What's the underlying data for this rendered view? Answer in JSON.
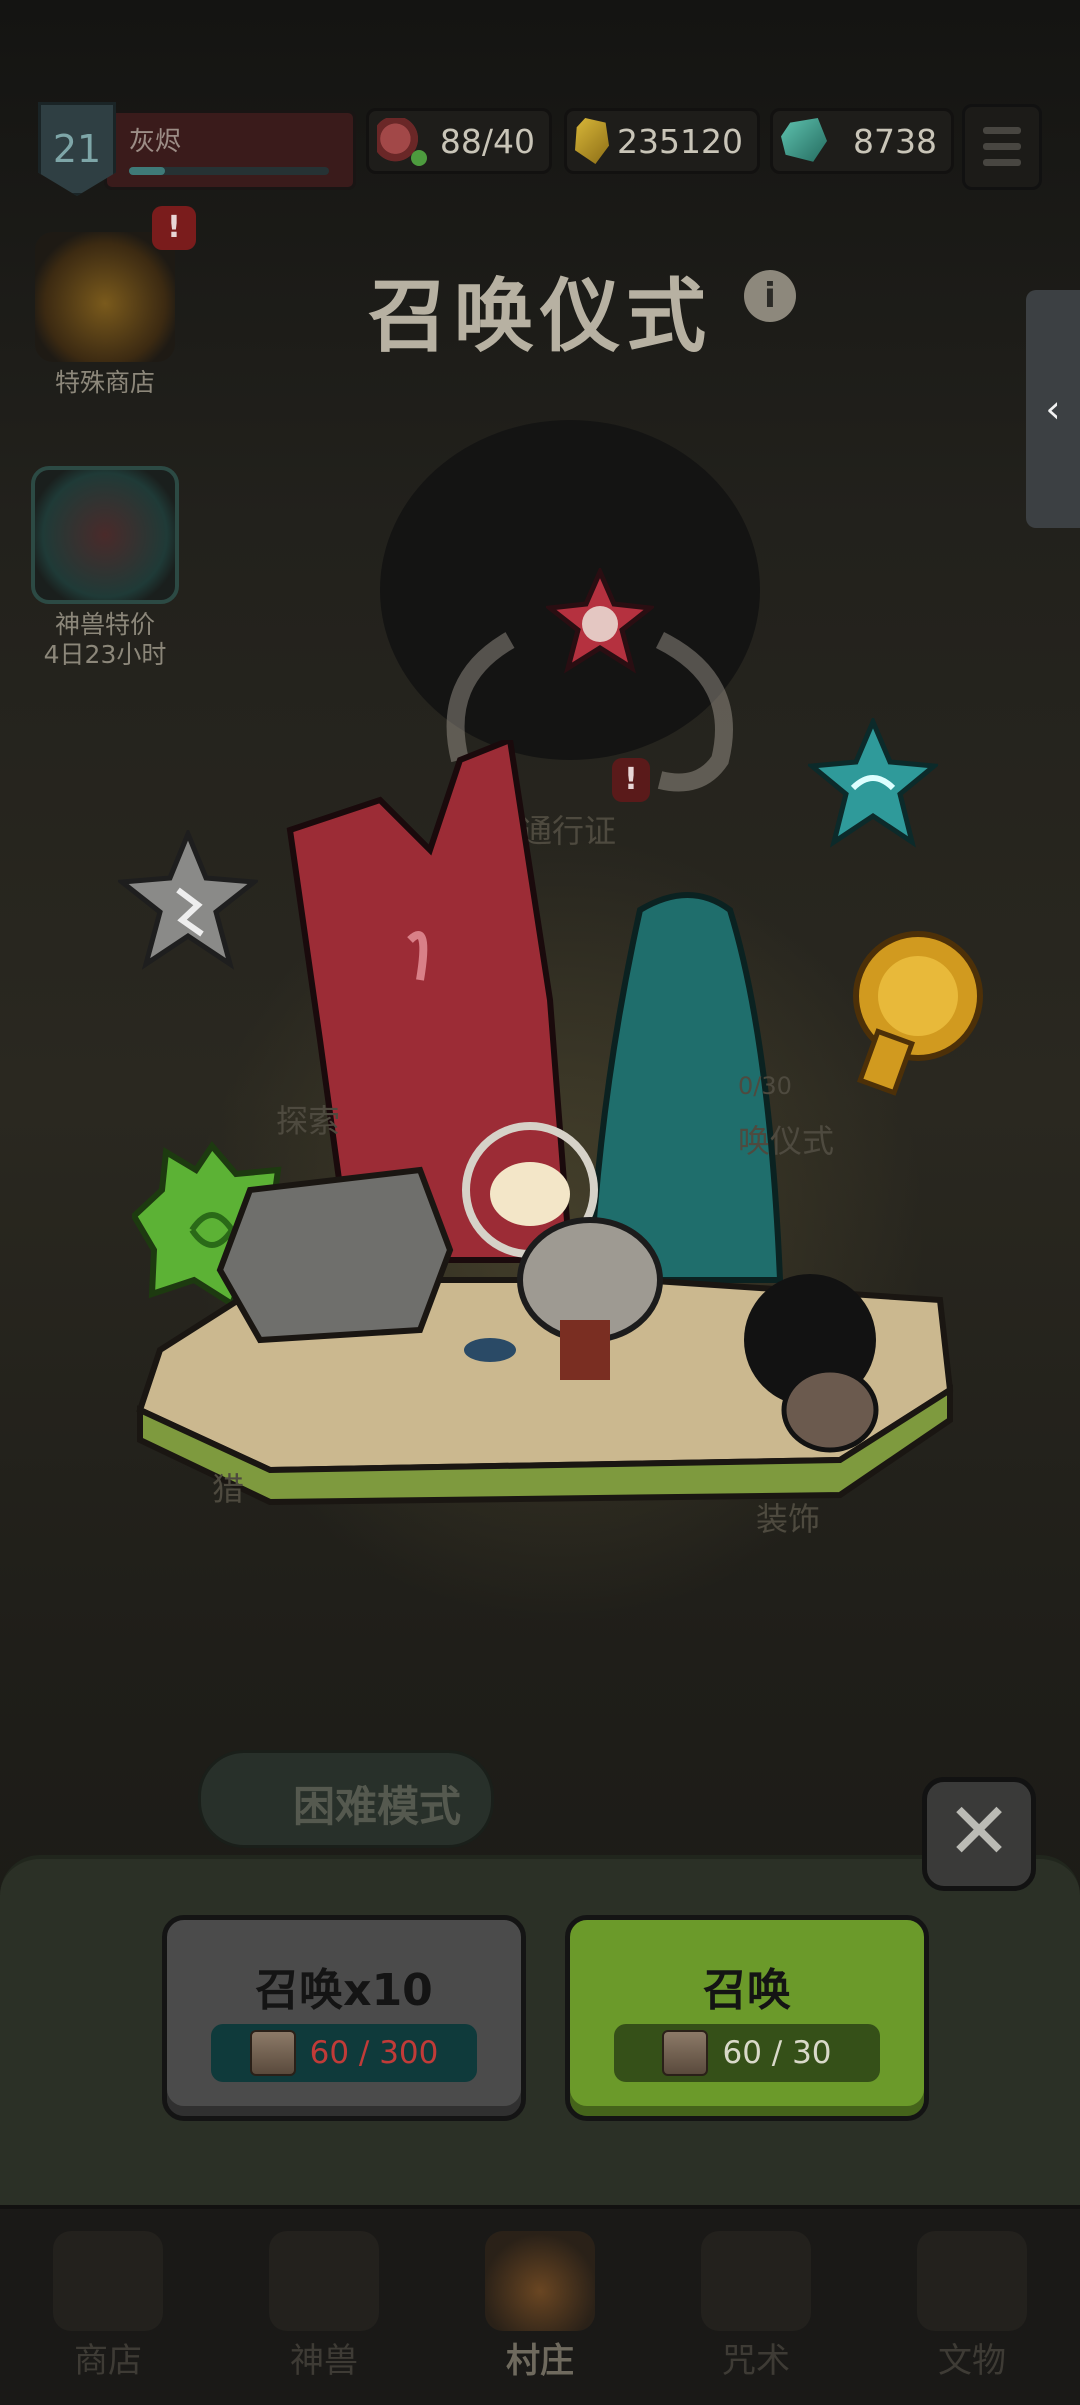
{
  "player": {
    "level": "21",
    "name": "灰烬"
  },
  "resources": [
    {
      "name": "meat-icon",
      "value": "88/40"
    },
    {
      "name": "gold-icon",
      "value": "235120"
    },
    {
      "name": "gem-icon",
      "value": "8738"
    }
  ],
  "title": "召唤仪式",
  "side_tab": "‹",
  "widgets": {
    "special_shop": {
      "label": "特殊商店",
      "alert": "!"
    },
    "beast_deal": {
      "label": "神兽特价",
      "timer": "4日23小时"
    }
  },
  "scene_labels": {
    "pass": "通行证",
    "explore": "探索",
    "ritual": "唤仪式",
    "decor": "装饰",
    "hunt": "猎",
    "progress": "0/30"
  },
  "hard_mode": "困难模式",
  "close": "✕",
  "buttons": {
    "summon_x10": {
      "label": "召唤x10",
      "cost": "60 / 300"
    },
    "summon_one": {
      "label": "召唤",
      "cost": "60 / 30"
    }
  },
  "nav": [
    {
      "label": "商店"
    },
    {
      "label": "神兽"
    },
    {
      "label": "村庄"
    },
    {
      "label": "咒术"
    },
    {
      "label": "文物"
    }
  ],
  "colors": {
    "summon_green": "#6b9a2a",
    "summon_grey": "#4b4b4b",
    "cost_insufficient": "#c13b38"
  }
}
